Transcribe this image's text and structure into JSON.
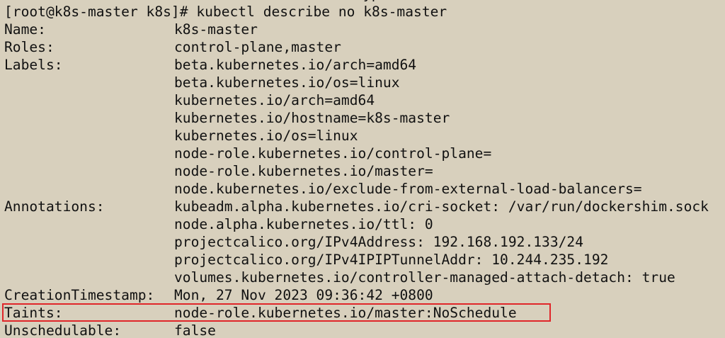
{
  "terminal": {
    "partial_prev_line": "yp",
    "prompt": "[root@k8s-master k8s]# kubectl describe no k8s-master",
    "rows": [
      {
        "label": "Name:",
        "value": "k8s-master"
      },
      {
        "label": "Roles:",
        "value": "control-plane,master"
      },
      {
        "label": "Labels:",
        "value": "beta.kubernetes.io/arch=amd64"
      },
      {
        "label": "",
        "value": "beta.kubernetes.io/os=linux"
      },
      {
        "label": "",
        "value": "kubernetes.io/arch=amd64"
      },
      {
        "label": "",
        "value": "kubernetes.io/hostname=k8s-master"
      },
      {
        "label": "",
        "value": "kubernetes.io/os=linux"
      },
      {
        "label": "",
        "value": "node-role.kubernetes.io/control-plane="
      },
      {
        "label": "",
        "value": "node-role.kubernetes.io/master="
      },
      {
        "label": "",
        "value": "node.kubernetes.io/exclude-from-external-load-balancers="
      },
      {
        "label": "Annotations:",
        "value": "kubeadm.alpha.kubernetes.io/cri-socket: /var/run/dockershim.sock"
      },
      {
        "label": "",
        "value": "node.alpha.kubernetes.io/ttl: 0"
      },
      {
        "label": "",
        "value": "projectcalico.org/IPv4Address: 192.168.192.133/24"
      },
      {
        "label": "",
        "value": "projectcalico.org/IPv4IPIPTunnelAddr: 10.244.235.192"
      },
      {
        "label": "",
        "value": "volumes.kubernetes.io/controller-managed-attach-detach: true"
      },
      {
        "label": "CreationTimestamp:",
        "value": "Mon, 27 Nov 2023 09:36:42 +0800"
      },
      {
        "label": "Taints:",
        "value": "node-role.kubernetes.io/master:NoSchedule"
      },
      {
        "label": "Unschedulable:",
        "value": "false"
      }
    ]
  },
  "colors": {
    "background": "#d8d0bd",
    "text": "#111111",
    "highlight_border": "#e0262a"
  }
}
